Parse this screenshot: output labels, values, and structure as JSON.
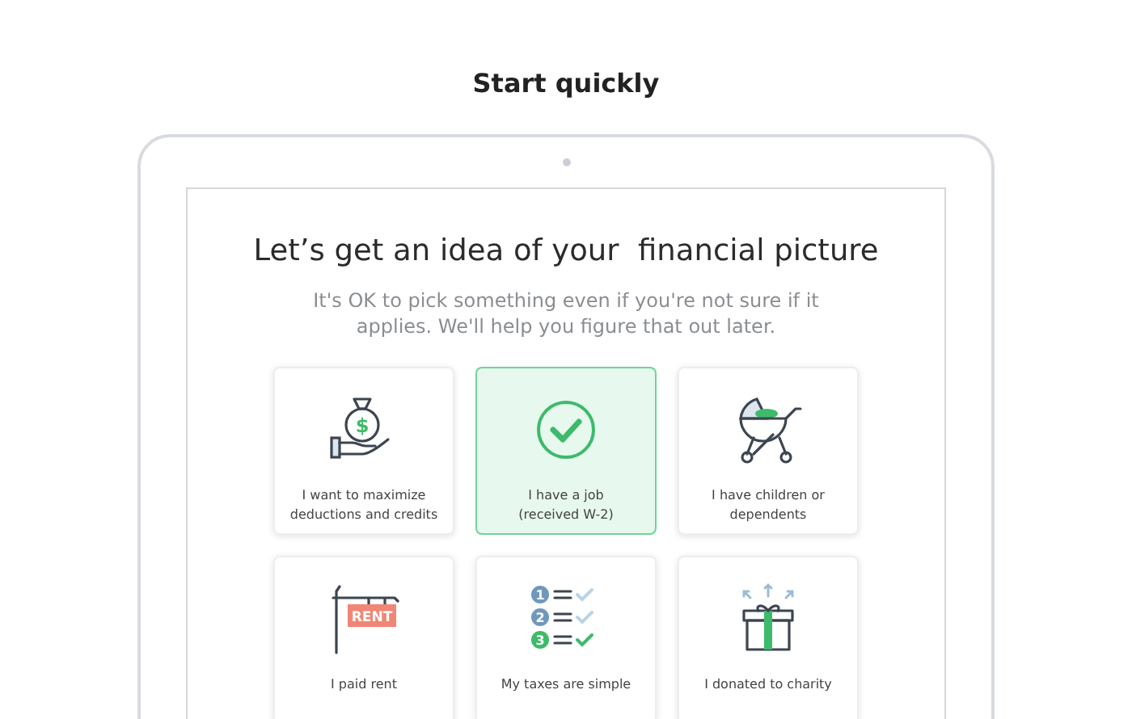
{
  "heading": "Start quickly",
  "screen": {
    "title": "Let’s get an idea of your  financial picture",
    "subtitle": "It's OK to pick something even if you're not sure if it applies. We'll help you figure that out later.",
    "cards": [
      {
        "label": "I want to maximize deductions and credits",
        "selected": false,
        "icon_text": "$"
      },
      {
        "label": "I have a job\n(received W-2)",
        "selected": true
      },
      {
        "label": "I have children or dependents",
        "selected": false
      },
      {
        "label": "I paid rent",
        "selected": false,
        "icon_text": "RENT"
      },
      {
        "label": "My taxes are simple",
        "selected": false,
        "steps": [
          "1",
          "2",
          "3"
        ]
      },
      {
        "label": "I donated to charity",
        "selected": false
      }
    ]
  }
}
